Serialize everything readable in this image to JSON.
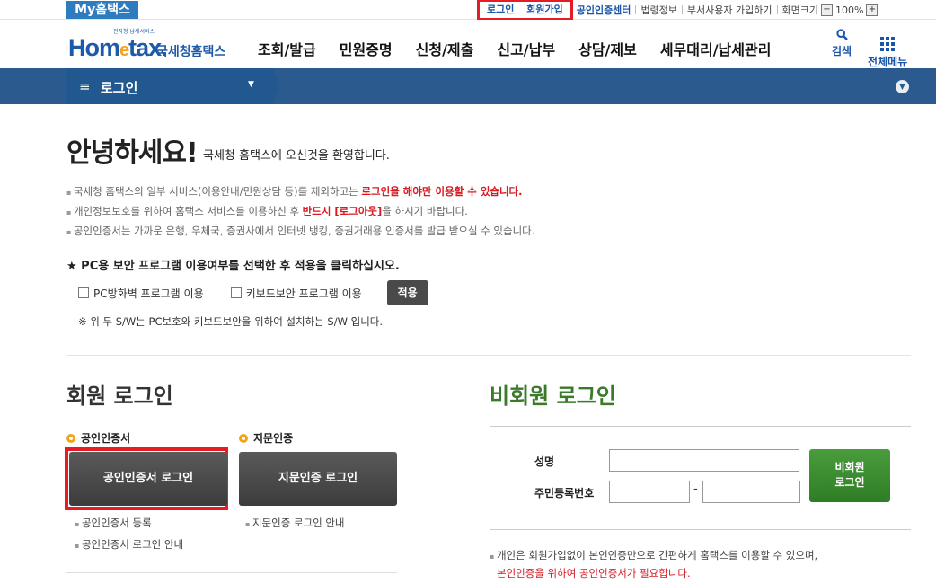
{
  "topbar": {
    "my_hometax": "My홈택스",
    "login": "로그인",
    "signup": "회원가입",
    "cert_center": "공인인증센터",
    "law_info": "법령정보",
    "dept_user_signup": "부서사용자 가입하기",
    "screen_size": "화면크기",
    "zoom_minus": "−",
    "zoom_value": "100%",
    "zoom_plus": "+"
  },
  "header": {
    "logo_tagline": "전자청 납세서비스",
    "logo_text_home": "Hom",
    "logo_text_e": "e",
    "logo_text_tax": "tax.",
    "logo_korean": "국세청홈택스",
    "nav": [
      "조회/발급",
      "민원증명",
      "신청/제출",
      "신고/납부",
      "상담/제보",
      "세무대리/납세관리"
    ],
    "search_label": "검색",
    "all_menu_label": "전체메뉴"
  },
  "location": {
    "menu_icon": "≡",
    "current": "로그인"
  },
  "welcome": {
    "title": "안녕하세요!",
    "subtitle": "국세청 홈택스에 오신것을 환영합니다.",
    "note1_a": "국세청 홈택스의 일부 서비스(이용안내/민원상담 등)를 제외하고는 ",
    "note1_b": "로그인을 해야만 이용할 수 있습니다.",
    "note2_a": "개인정보보호를 위하여 홈택스 서비스를 이용하신 후 ",
    "note2_b": "반드시 [로그아웃]",
    "note2_c": "을 하시기 바랍니다.",
    "note3": "공인인증서는 가까운 은행, 우체국, 증권사에서 인터넷 뱅킹, 증권거래용 인증서를 발급 받으실 수 있습니다."
  },
  "security": {
    "title": "★ PC용 보안 프로그램 이용여부를 선택한 후 적용을 클릭하십시오.",
    "firewall_label": "PC방화벽 프로그램 이용",
    "keyboard_label": "키보드보안 프로그램 이용",
    "apply_label": "적용",
    "note": "※ 위 두 S/W는 PC보호와 키보드보안을 위하여 설치하는 S/W 입니다."
  },
  "member_login": {
    "title": "회원 로그인",
    "cert_heading": "공인인증서",
    "cert_button": "공인인증서 로그인",
    "cert_links": [
      "공인인증서 등록",
      "공인인증서 로그인 안내"
    ],
    "finger_heading": "지문인증",
    "finger_button": "지문인증 로그인",
    "finger_links": [
      "지문인증 로그인 안내"
    ]
  },
  "nonmember_login": {
    "title": "비회원 로그인",
    "name_label": "성명",
    "rrn_label": "주민등록번호",
    "rrn_separator": "-",
    "name_value": "",
    "rrn_front_value": "",
    "rrn_back_value": "",
    "button_line1": "비회원",
    "button_line2": "로그인",
    "note_line1": "개인은 회원가입없이 본인인증만으로 간편하게 홈택스를 이용할 수 있으며,",
    "note_line2": "본인인증을 위하여 공인인증서가 필요합니다."
  },
  "colors": {
    "brand_blue": "#1e5aa8",
    "location_bar": "#2b5a8f",
    "highlight_red": "#e51c23",
    "nonmember_green": "#3b7a2a",
    "accent_orange": "#f0a31b"
  }
}
